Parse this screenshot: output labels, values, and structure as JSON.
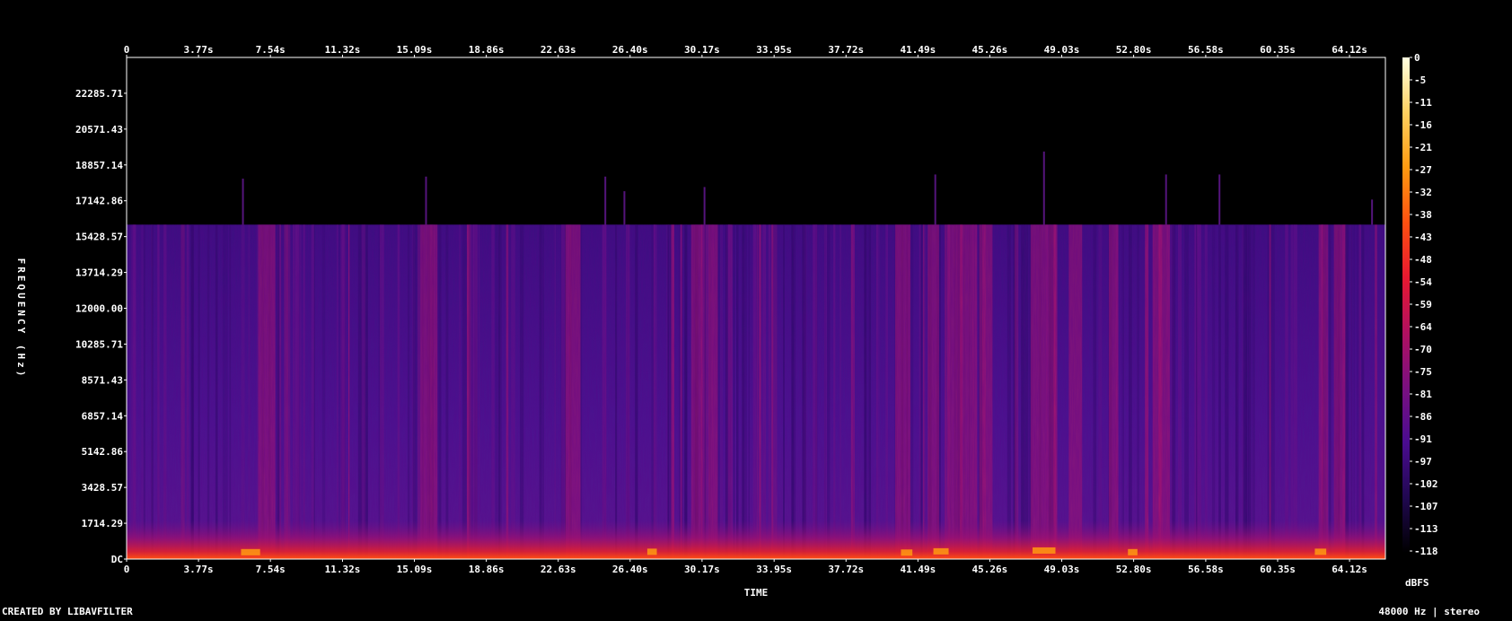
{
  "chart_data": {
    "type": "heatmap",
    "title": "",
    "xlabel": "TIME",
    "ylabel": "FREQUENCY (Hz)",
    "x_ticks": [
      "0",
      "3.77s",
      "7.54s",
      "11.32s",
      "15.09s",
      "18.86s",
      "22.63s",
      "26.40s",
      "30.17s",
      "33.95s",
      "37.72s",
      "41.49s",
      "45.26s",
      "49.03s",
      "52.80s",
      "56.58s",
      "60.35s",
      "64.12s"
    ],
    "x_tick_values": [
      0,
      3.77,
      7.54,
      11.32,
      15.09,
      18.86,
      22.63,
      26.4,
      30.17,
      33.95,
      37.72,
      41.49,
      45.26,
      49.03,
      52.8,
      56.58,
      60.35,
      64.12
    ],
    "xlim": [
      0,
      66
    ],
    "y_ticks": [
      "DC",
      "1714.29",
      "3428.57",
      "5142.86",
      "6857.14",
      "8571.43",
      "10285.71",
      "12000.00",
      "13714.29",
      "15428.57",
      "17142.86",
      "18857.14",
      "20571.43",
      "22285.71"
    ],
    "y_tick_values": [
      0,
      1714.29,
      3428.57,
      5142.86,
      6857.14,
      8571.43,
      10285.71,
      12000.0,
      13714.29,
      15428.57,
      17142.86,
      18857.14,
      20571.43,
      22285.71
    ],
    "ylim": [
      0,
      24000
    ],
    "colorbar": {
      "label": "dBFS",
      "ticks": [
        "0",
        "-5",
        "-11",
        "-16",
        "-21",
        "-27",
        "-32",
        "-38",
        "-43",
        "-48",
        "-54",
        "-59",
        "-64",
        "-70",
        "-75",
        "-81",
        "-86",
        "-91",
        "-97",
        "-102",
        "-107",
        "-113",
        "-118"
      ],
      "range": [
        -120,
        0
      ],
      "stops": [
        "#ffffe0",
        "#ffd060",
        "#ff9a10",
        "#ff5010",
        "#e81830",
        "#b01060",
        "#7a1080",
        "#4a0c90",
        "#200850",
        "#000000"
      ]
    },
    "cutoff_hz": 16000,
    "colors": {
      "background_high": "#000000",
      "body": "#4a1590",
      "body_dark": "#2c0c6a",
      "streak": "#b0186e",
      "low_band": "#e02030",
      "hot": "#ff9a10"
    }
  },
  "footer": {
    "credit": "CREATED BY LIBAVFILTER",
    "info": "48000 Hz | stereo"
  }
}
